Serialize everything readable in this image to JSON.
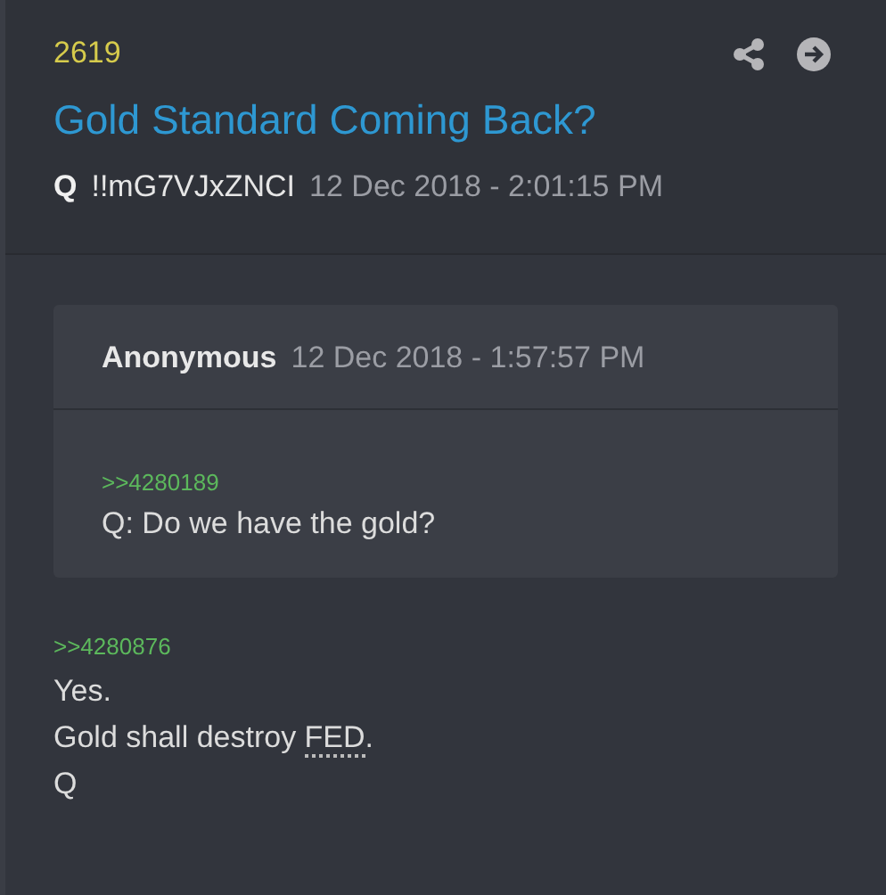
{
  "post": {
    "number": "2619",
    "title": "Gold Standard Coming Back?",
    "author": "Q",
    "tripcode": "!!mG7VJxZNCI",
    "timestamp": "12 Dec 2018 - 2:01:15 PM"
  },
  "quote": {
    "author": "Anonymous",
    "timestamp": "12 Dec 2018 - 1:57:57 PM",
    "reference": ">>4280189",
    "lines": [
      {
        "parts": [
          {
            "text": "Q: Do we have the gold?"
          }
        ]
      }
    ]
  },
  "reply": {
    "reference": ">>4280876",
    "lines": [
      {
        "parts": [
          {
            "text": "Yes."
          }
        ]
      },
      {
        "parts": [
          {
            "text": "Gold shall destroy "
          },
          {
            "text": "FED",
            "kind": "abbr"
          },
          {
            "text": "."
          }
        ]
      },
      {
        "parts": [
          {
            "text": "Q"
          }
        ]
      }
    ]
  }
}
